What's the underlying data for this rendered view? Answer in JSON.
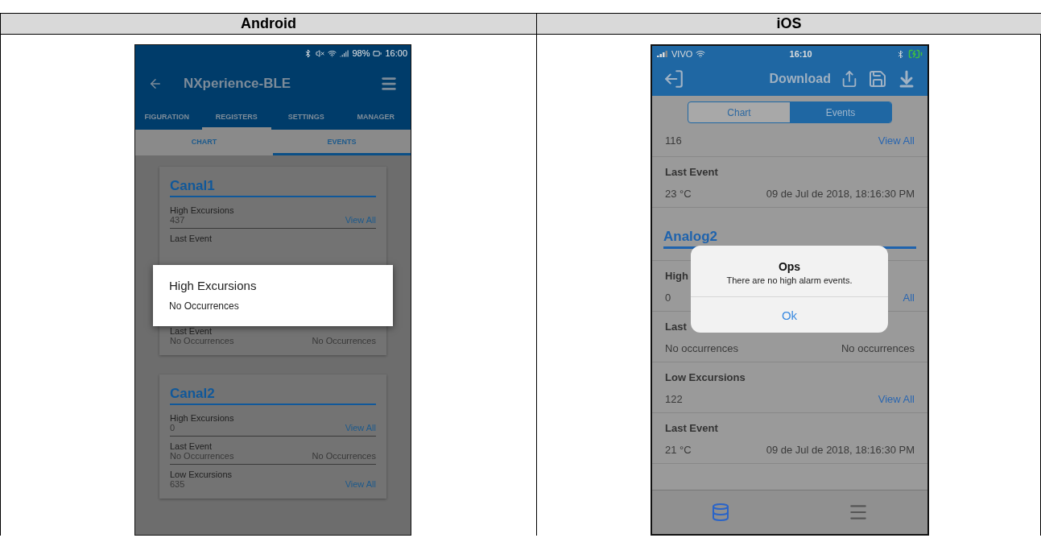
{
  "table": {
    "columns": [
      "Android",
      "iOS"
    ]
  },
  "android": {
    "status": {
      "battery": "98%",
      "time": "16:00"
    },
    "title": "NXperience-BLE",
    "tabs": [
      {
        "label": "FIGURATION",
        "selected": false
      },
      {
        "label": "REGISTERS",
        "selected": true
      },
      {
        "label": "SETTINGS",
        "selected": false
      },
      {
        "label": "MANAGER",
        "selected": false
      }
    ],
    "subtabs": [
      {
        "label": "CHART",
        "selected": false
      },
      {
        "label": "EVENTS",
        "selected": true
      }
    ],
    "cards": [
      {
        "title": "Canal1",
        "rows": [
          {
            "label": "High Excursions",
            "value": "437",
            "action": "View All"
          },
          {
            "label": "Last Event"
          },
          {
            "label": "Last Event",
            "value": "No Occurrences",
            "detail": "No Occurrences"
          }
        ]
      },
      {
        "title": "Canal2",
        "rows": [
          {
            "label": "High Excursions",
            "value": "0",
            "action": "View All"
          },
          {
            "label": "Last Event",
            "value": "No Occurrences",
            "detail": "No Occurrences"
          },
          {
            "label": "Low Excursions",
            "value": "635",
            "action": "View All"
          }
        ]
      }
    ],
    "dialog": {
      "title": "High Excursions",
      "message": "No Occurrences"
    }
  },
  "ios": {
    "status": {
      "carrier": "VIVO",
      "time": "16:10"
    },
    "title": "Download",
    "segments": [
      {
        "label": "Chart",
        "selected": false
      },
      {
        "label": "Events",
        "selected": true
      }
    ],
    "top_rows": [
      {
        "value": "116",
        "action": "View All"
      },
      {
        "label": "Last Event",
        "value": "23 °C",
        "detail": "09 de Jul de 2018, 18:16:30 PM"
      }
    ],
    "section": "Analog2",
    "rows": [
      {
        "label": "High",
        "value": "0",
        "action": "All"
      },
      {
        "label": "Last",
        "value": "No occurrences",
        "detail": "No occurrences"
      },
      {
        "label": "Low Excursions",
        "value": "122",
        "action": "View All"
      },
      {
        "label": "Last Event",
        "value": "21 °C",
        "detail": "09 de Jul de 2018, 18:16:30 PM"
      }
    ],
    "alert": {
      "title": "Ops",
      "message": "There are no high alarm events.",
      "button": "Ok"
    },
    "tabbar": [
      {
        "kind": "database",
        "selected": true
      },
      {
        "kind": "menu",
        "selected": false
      }
    ]
  }
}
